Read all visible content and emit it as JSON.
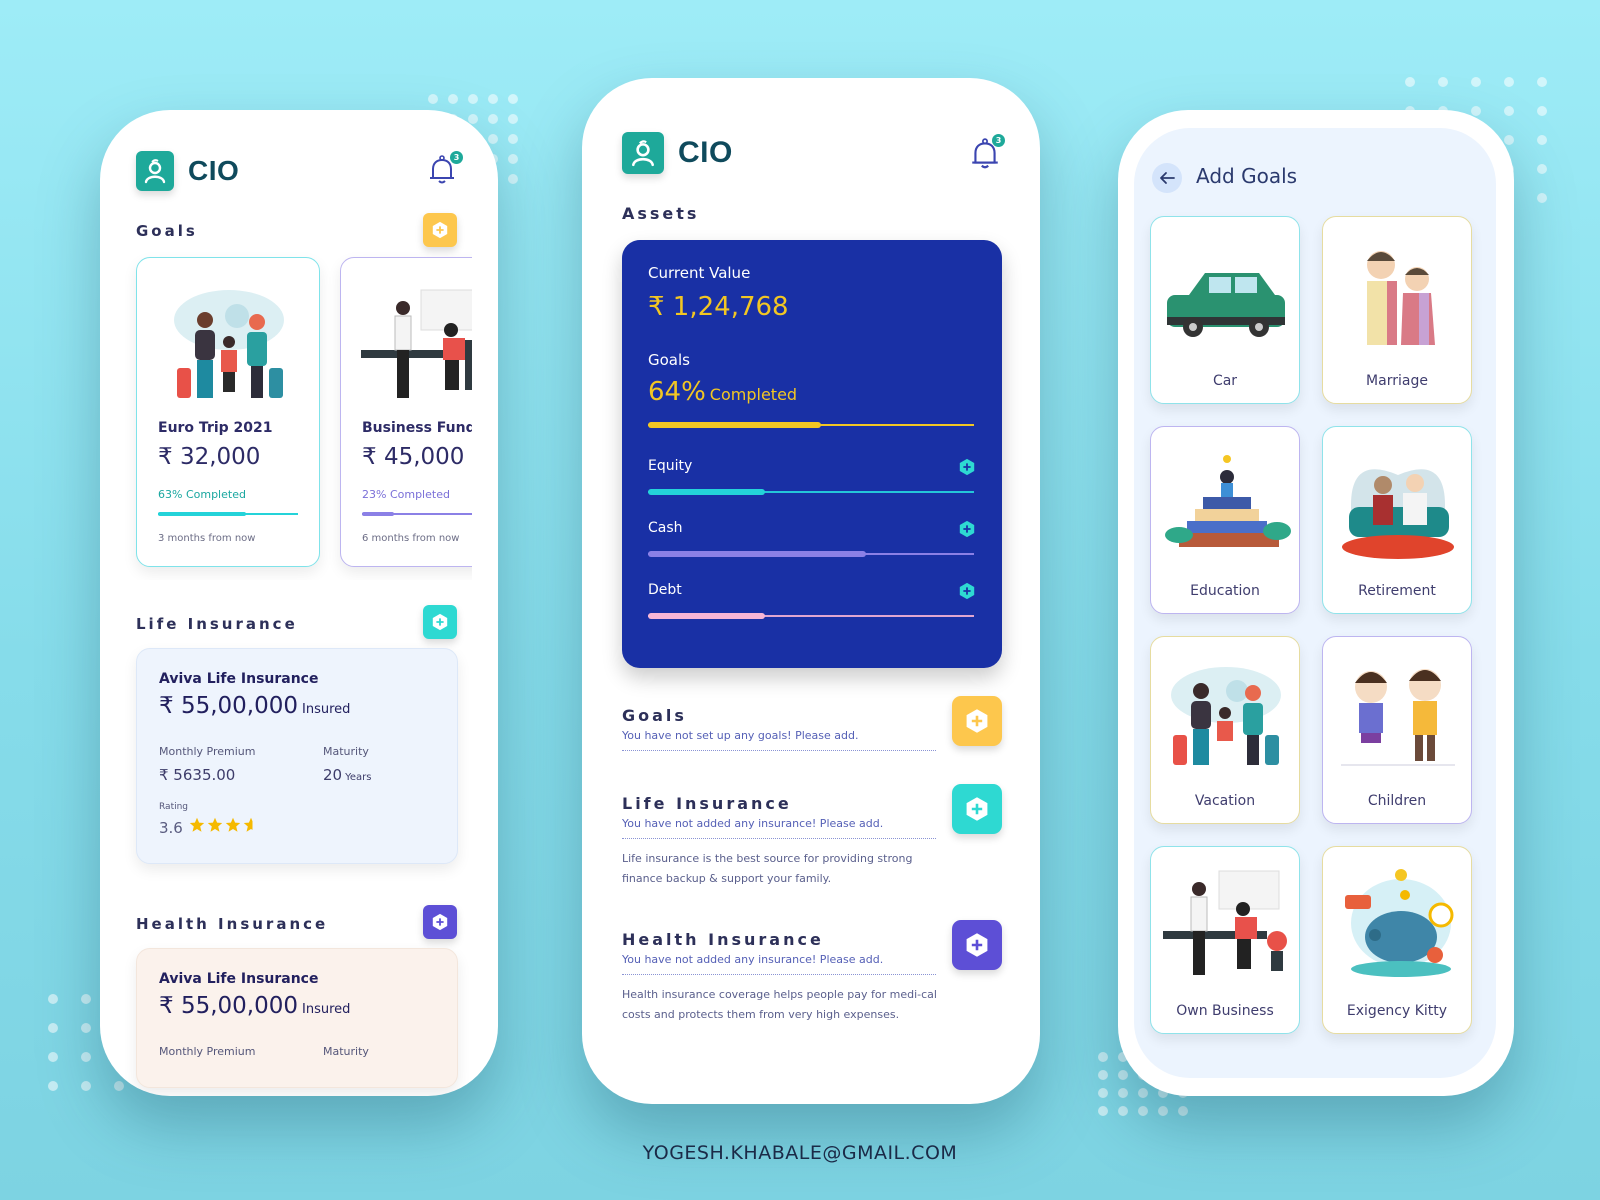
{
  "colors": {
    "teal": "#1ea99a",
    "yellow": "#fdc74d",
    "aqua": "#2ed9d2",
    "purple": "#5d4fd6",
    "navy_card": "#1930a5",
    "gold": "#f2c623"
  },
  "footer": {
    "email": "YOGESH.KHABALE@GMAIL.COM"
  },
  "left_phone": {
    "app_name": "CIO",
    "notification_count": "3",
    "goals_title": "Goals",
    "goals": [
      {
        "name": "Euro Trip 2021",
        "amount": "₹ 32,000",
        "completed_label": "63% Completed",
        "progress": 0.63,
        "time": "3 months from now",
        "color": "#24d3d9",
        "border": "#7fe3ea"
      },
      {
        "name": "Business Funds",
        "amount": "₹ 45,000",
        "completed_label": "23% Completed",
        "progress": 0.23,
        "time": "6 months from now",
        "color": "#8b80e6",
        "border": "#bdb5f0"
      }
    ],
    "life_insurance": {
      "title": "Life Insurance",
      "name": "Aviva Life Insurance",
      "amount": "₹ 55,00,000",
      "amount_suffix": "Insured",
      "premium_label": "Monthly Premium",
      "premium_value": "₹ 5635.00",
      "maturity_label": "Maturity",
      "maturity_value": "20",
      "maturity_unit": "Years",
      "rating_label": "Rating",
      "rating_value": "3.6",
      "rating_stars": 3.6
    },
    "health_insurance": {
      "title": "Health Insurance",
      "name": "Aviva Life Insurance",
      "amount": "₹ 55,00,000",
      "amount_suffix": "Insured",
      "premium_label": "Monthly Premium",
      "maturity_label": "Maturity"
    }
  },
  "mid_phone": {
    "app_name": "CIO",
    "notification_count": "3",
    "assets_title": "Assets",
    "current_value_label": "Current Value",
    "current_value": "₹ 1,24,768",
    "goals_label": "Goals",
    "goals_percent": "64%",
    "goals_completed_word": "Completed",
    "goals_progress": 0.53,
    "asset_rows": [
      {
        "label": "Equity",
        "progress": 0.36,
        "fill": "#24d3d9",
        "track": "#24c6d9"
      },
      {
        "label": "Cash",
        "progress": 0.67,
        "fill": "#8b80e6",
        "track": "#8b80e6"
      },
      {
        "label": "Debt",
        "progress": 0.36,
        "fill": "#f7b6d6",
        "track": "#e0a6d0"
      }
    ],
    "sections": [
      {
        "title": "Goals",
        "subtitle": "You have not set up any goals! Please add.",
        "description": ""
      },
      {
        "title": "Life Insurance",
        "subtitle": "You have not added any insurance! Please add.",
        "description": "Life insurance is the best source for providing strong finance backup & support your family."
      },
      {
        "title": "Health Insurance",
        "subtitle": "You have not added any insurance! Please add.",
        "description": "Health insurance coverage helps people pay for medi-cal costs and protects them from very high expenses."
      }
    ]
  },
  "right_phone": {
    "title": "Add Goals",
    "tiles": [
      {
        "label": "Car",
        "border": "#8fe3ea"
      },
      {
        "label": "Marriage",
        "border": "#e6dca0"
      },
      {
        "label": "Education",
        "border": "#bdb5f0"
      },
      {
        "label": "Retirement",
        "border": "#8fe3ea"
      },
      {
        "label": "Vacation",
        "border": "#e6dca0"
      },
      {
        "label": "Children",
        "border": "#bdb5f0"
      },
      {
        "label": "Own Business",
        "border": "#8fe3ea"
      },
      {
        "label": "Exigency Kitty",
        "border": "#e6dca0"
      }
    ]
  }
}
